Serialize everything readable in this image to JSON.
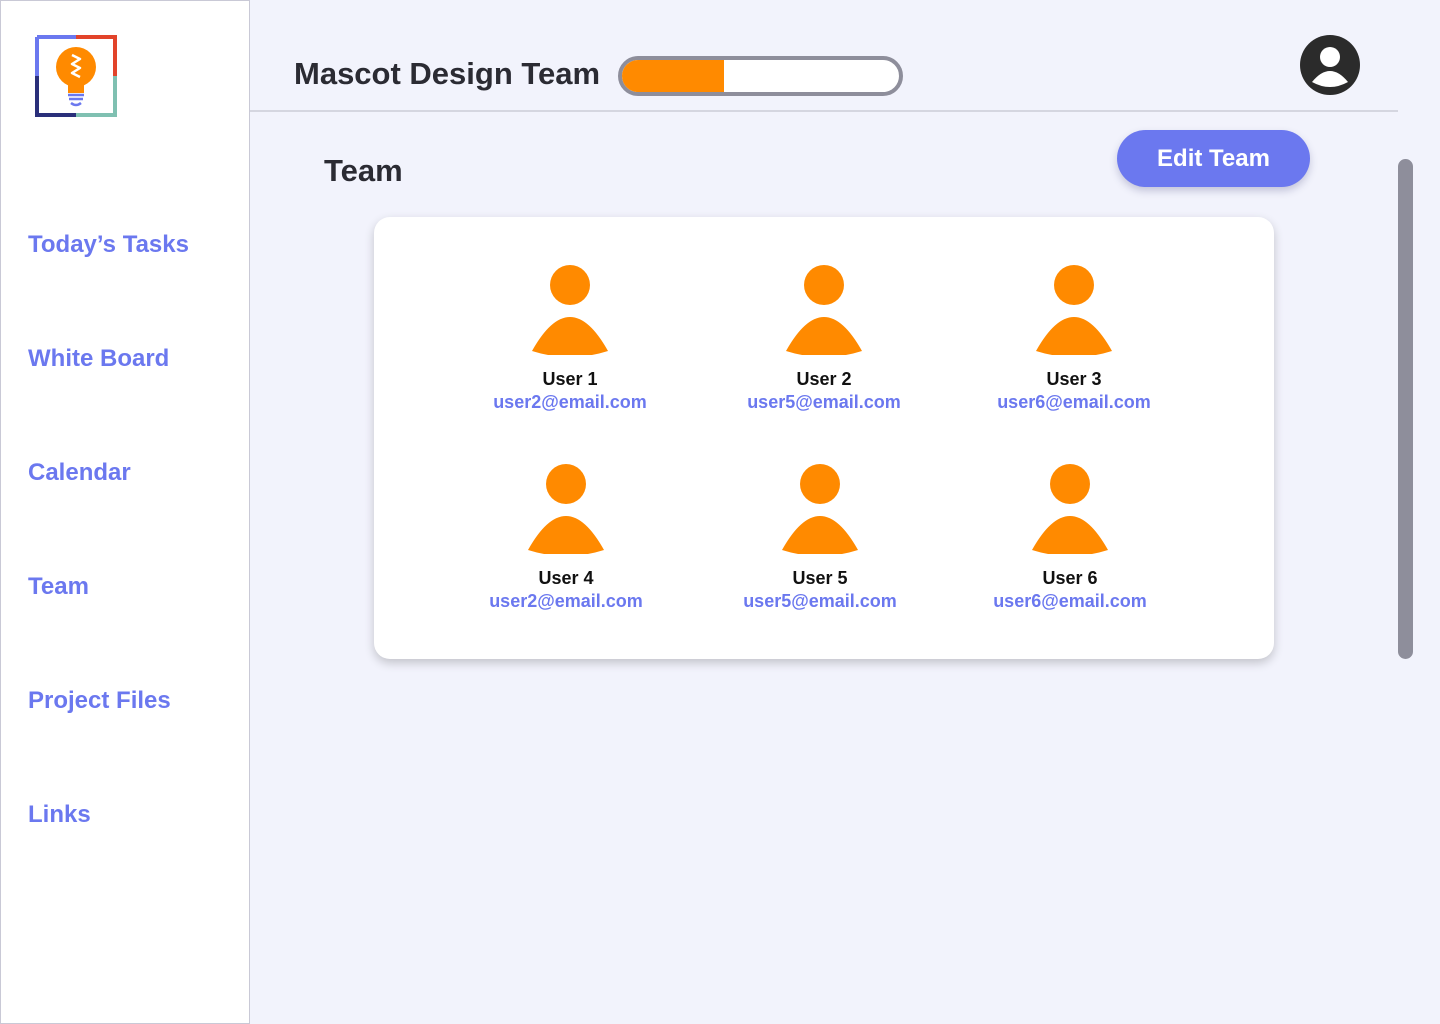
{
  "colors": {
    "accent": "#6b78ef",
    "orange": "#ff8a00",
    "background": "#f2f3fc",
    "text_dark": "#2b2b33"
  },
  "logo": {
    "icon": "lightbulb-icon"
  },
  "sidebar": {
    "items": [
      {
        "label": "Today’s Tasks"
      },
      {
        "label": "White Board"
      },
      {
        "label": "Calendar"
      },
      {
        "label": "Team"
      },
      {
        "label": "Project Files"
      },
      {
        "label": "Links"
      }
    ]
  },
  "header": {
    "title": "Mascot Design Team",
    "progress": 0.37,
    "avatar_icon": "user-avatar-icon"
  },
  "main": {
    "section_title": "Team",
    "edit_button": "Edit Team",
    "members": [
      {
        "name": "User 1",
        "email": "user2@email.com",
        "icon": "user-icon"
      },
      {
        "name": "User 2",
        "email": "user5@email.com",
        "icon": "user-icon"
      },
      {
        "name": "User 3",
        "email": "user6@email.com",
        "icon": "user-icon"
      },
      {
        "name": "User 4",
        "email": "user2@email.com",
        "icon": "user-icon"
      },
      {
        "name": "User 5",
        "email": "user5@email.com",
        "icon": "user-icon"
      },
      {
        "name": "User 6",
        "email": "user6@email.com",
        "icon": "user-icon"
      }
    ]
  }
}
